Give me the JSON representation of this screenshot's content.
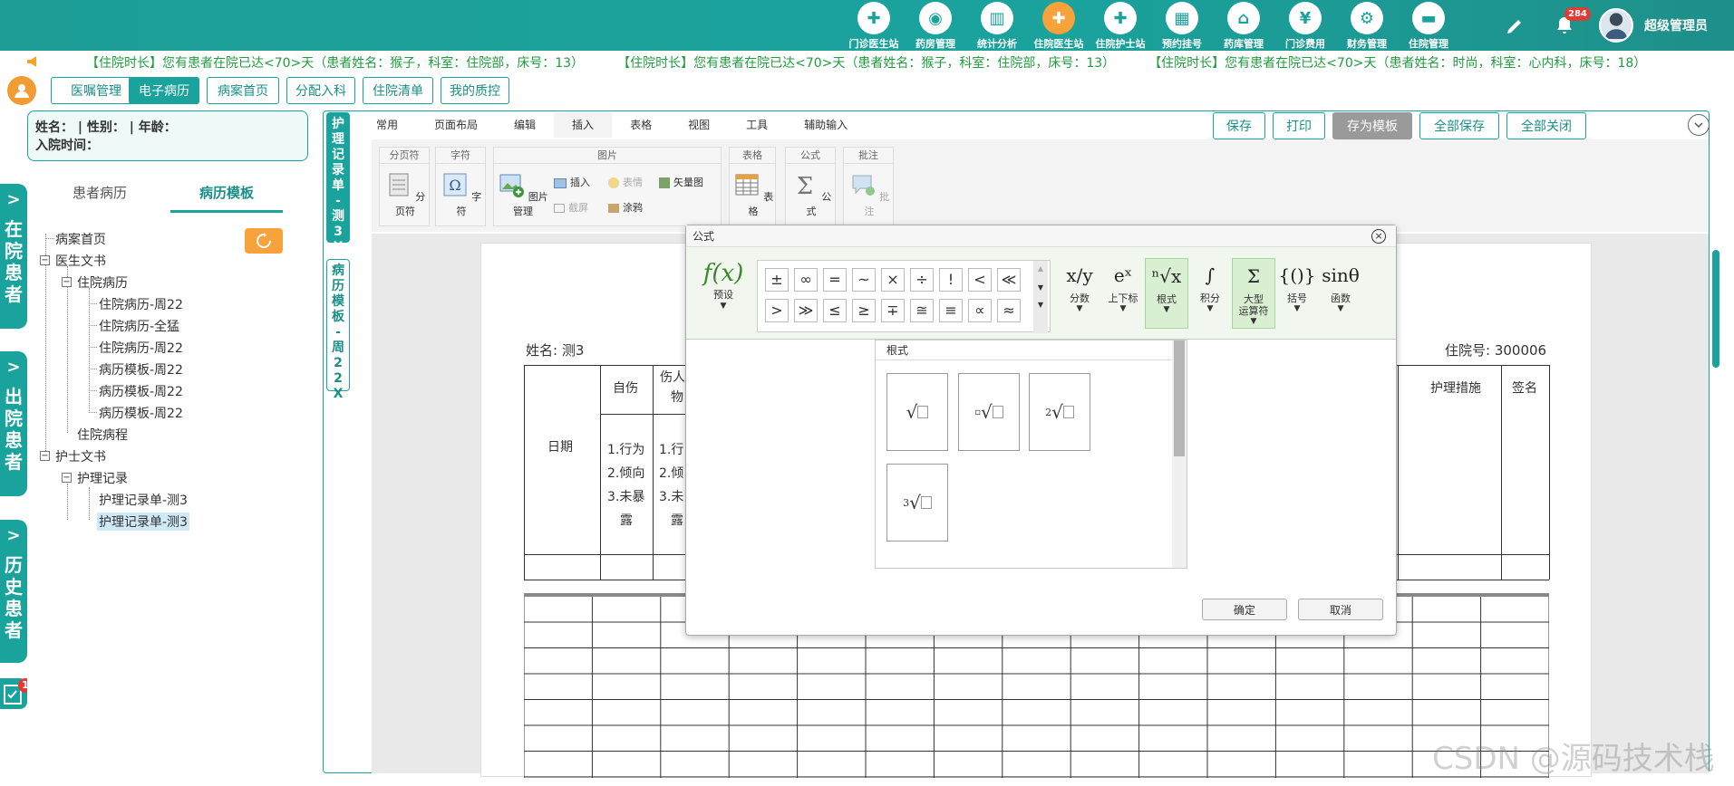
{
  "nav": {
    "items": [
      {
        "label": "门诊医生站",
        "icon": "doctor-icon"
      },
      {
        "label": "药房管理",
        "icon": "pill-icon"
      },
      {
        "label": "统计分析",
        "icon": "chart-icon"
      },
      {
        "label": "住院医生站",
        "icon": "inpatient-doctor-icon",
        "active": true
      },
      {
        "label": "住院护士站",
        "icon": "nurse-icon"
      },
      {
        "label": "预约挂号",
        "icon": "calendar-icon"
      },
      {
        "label": "药库管理",
        "icon": "warehouse-icon"
      },
      {
        "label": "门诊费用",
        "icon": "yen-icon"
      },
      {
        "label": "财务管理",
        "icon": "gear-icon"
      },
      {
        "label": "住院管理",
        "icon": "bed-icon"
      }
    ],
    "notification_count": "284",
    "username": "超级管理员"
  },
  "marquee": {
    "messages": [
      "【住院时长】您有患者在院已达<70>天（患者姓名：猴子，科室：住院部，床号：13）",
      "【住院时长】您有患者在院已达<70>天（患者姓名：猴子，科室：住院部，床号：13）",
      "【住院时长】您有患者在院已达<70>天（患者姓名：时尚，科室：心内科，床号：18）"
    ]
  },
  "tabs": [
    {
      "label": "医嘱管理"
    },
    {
      "label": "电子病历",
      "active": true
    },
    {
      "label": "病案首页"
    },
    {
      "label": "分配入科"
    },
    {
      "label": "住院清单"
    },
    {
      "label": "我的质控"
    }
  ],
  "side_tabs": [
    {
      "label": "在院患者"
    },
    {
      "label": "出院患者"
    },
    {
      "label": "历史患者"
    }
  ],
  "side_badge": "1",
  "patient": {
    "line1": "姓名：   | 性别：   | 年龄：",
    "line2": "入院时间："
  },
  "left_panel": {
    "tab_history": "患者病历",
    "tab_template": "病历模板"
  },
  "tree": {
    "home": "病案首页",
    "doctor_docs": "医生文书",
    "inpatient_record": "住院病历",
    "records": [
      "住院病历-周22",
      "住院病历-全猛",
      "住院病历-周22",
      "病历模板-周22",
      "病历模板-周22",
      "病历模板-周22"
    ],
    "course": "住院病程",
    "nurse_docs": "护士文书",
    "nursing_record": "护理记录",
    "nursing_items": [
      "护理记录单-测3",
      "护理记录单-测3"
    ]
  },
  "doc_tabs": {
    "active": "护理记录单-测3 X",
    "inactive": "病历模板-周22 X"
  },
  "ribbon": {
    "tabs": [
      "常用",
      "页面布局",
      "编辑",
      "插入",
      "表格",
      "视图",
      "工具",
      "辅助输入"
    ],
    "active_tab": "插入",
    "groups": {
      "page_break": {
        "title": "分页符",
        "btn": "分页符"
      },
      "char": {
        "title": "字符",
        "btn": "字符"
      },
      "image": {
        "title": "图片",
        "manage": "图片管理",
        "insert": "插入",
        "emoji": "表情",
        "vector": "矢量图",
        "screenshot": "截屏",
        "scribble": "涂鸦"
      },
      "table": {
        "title": "表格",
        "btn": "表格"
      },
      "formula": {
        "title": "公式",
        "btn": "公式"
      },
      "comment": {
        "title": "批注",
        "btn": "批注"
      }
    }
  },
  "actions": {
    "save": "保存",
    "print": "打印",
    "save_template": "存为模板",
    "save_all": "全部保存",
    "close_all": "全部关闭"
  },
  "document": {
    "name_label": "姓名: 测3",
    "inpatient_no": "住院号: 300006",
    "col_date": "日期",
    "col_self_harm": "自伤",
    "col_injure": "伤人",
    "col_injure2": "物",
    "col_measures": "护理措施",
    "col_sign": "签名",
    "items_a": [
      "1.行为",
      "2.倾向",
      "3.未暴",
      "露"
    ],
    "items_b": [
      "1.行",
      "2.倾",
      "3.未",
      "露"
    ]
  },
  "dialog": {
    "title": "公式",
    "preset_label": "预设",
    "symbols_row1": [
      "±",
      "∞",
      "=",
      "~",
      "×",
      "÷",
      "!",
      "<",
      "≪"
    ],
    "symbols_row2": [
      ">",
      "≫",
      "≤",
      "≥",
      "∓",
      "≅",
      "≡",
      "∝",
      "≈"
    ],
    "tools": [
      {
        "label": "分数",
        "glyph": "x/y"
      },
      {
        "label": "上下标",
        "glyph": "eˣ"
      },
      {
        "label": "根式",
        "glyph": "ⁿ√x",
        "active": true
      },
      {
        "label": "积分",
        "glyph": "∫"
      },
      {
        "label": "大型\n运算符",
        "glyph": "Σ",
        "active": true
      },
      {
        "label": "括号",
        "glyph": "{()}"
      },
      {
        "label": "函数",
        "glyph": "sinθ"
      }
    ],
    "radical_title": "根式",
    "confirm": "确定",
    "cancel": "取消"
  },
  "watermark": "CSDN @源码技术栈"
}
